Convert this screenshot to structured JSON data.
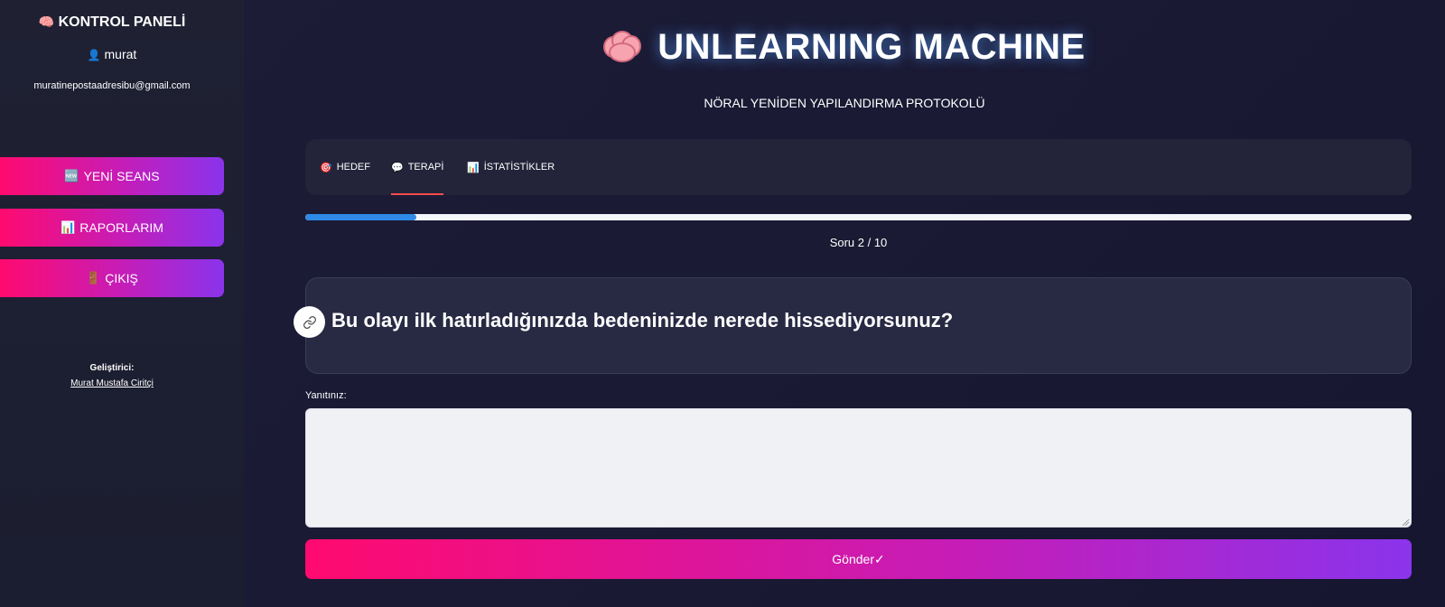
{
  "sidebar": {
    "title": "KONTROL PANELİ",
    "title_icon": "brain-icon",
    "username": "murat",
    "user_icon": "user-icon",
    "email": "muratinepostaadresibu@gmail.com",
    "buttons": [
      {
        "icon": "🆕",
        "icon_name": "new-icon",
        "label": "YENİ SEANS"
      },
      {
        "icon": "📊",
        "icon_name": "chart-icon",
        "label": "RAPORLARIM"
      },
      {
        "icon": "🚪",
        "icon_name": "door-icon",
        "label": "ÇIKIŞ"
      }
    ],
    "developer_label": "Geliştirici:",
    "developer_name": "Murat Mustafa Ciritçi"
  },
  "header": {
    "title": "UNLEARNING MACHINE",
    "subtitle": "NÖRAL YENİDEN YAPILANDIRMA PROTOKOLÜ"
  },
  "tabs": [
    {
      "icon": "🎯",
      "icon_name": "target-icon",
      "label": "HEDEF",
      "active": false
    },
    {
      "icon": "💬",
      "icon_name": "speech-bubble-icon",
      "label": "TERAPİ",
      "active": true
    },
    {
      "icon": "📊",
      "icon_name": "chart-icon",
      "label": "İSTATİSTİKLER",
      "active": false
    }
  ],
  "progress": {
    "current": 2,
    "total": 10,
    "fraction": 0.1,
    "text": "Soru 2 / 10"
  },
  "question": {
    "text": "Bu olayı ilk hatırladığınızda bedeninizde nerede hissediyorsunuz?"
  },
  "answer": {
    "label": "Yanıtınız:",
    "value": ""
  },
  "submit": {
    "label": "Gönder✓"
  },
  "colors": {
    "accent_pink": "#ff0a6f",
    "accent_purple": "#8a34ec",
    "progress_blue": "#2e8ae6",
    "tab_underline": "#ff4b4b",
    "background": "#1a1a34"
  }
}
